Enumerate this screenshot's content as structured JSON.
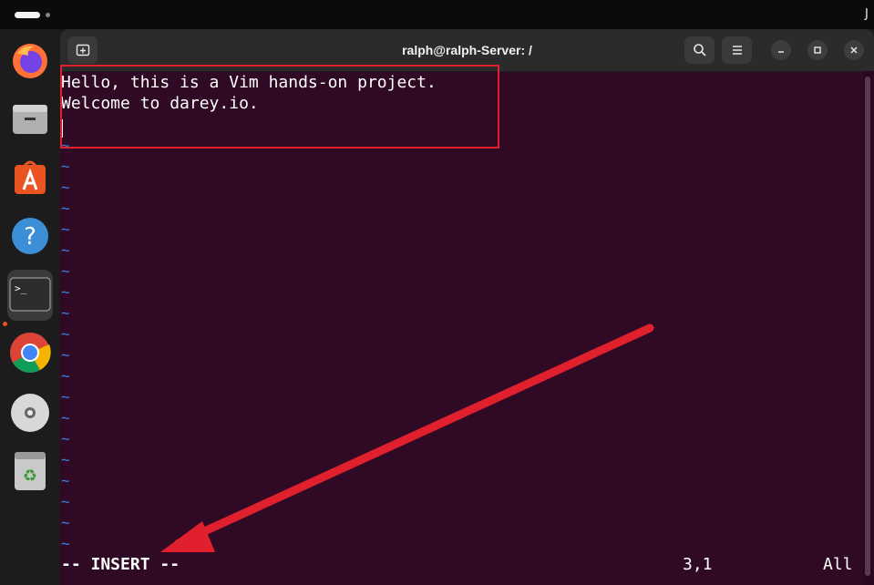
{
  "topbar": {
    "edge_glyph": "J"
  },
  "dock": {
    "items": [
      {
        "name": "firefox"
      },
      {
        "name": "files"
      },
      {
        "name": "app-center"
      },
      {
        "name": "help"
      },
      {
        "name": "terminal"
      },
      {
        "name": "chrome"
      },
      {
        "name": "disc"
      },
      {
        "name": "trash"
      }
    ]
  },
  "window": {
    "title": "ralph@ralph-Server: /",
    "new_tab_icon": "new-tab-icon",
    "search_icon": "search-icon",
    "menu_icon": "hamburger-menu-icon"
  },
  "vim": {
    "lines": [
      "Hello, this is a Vim hands-on project.",
      "Welcome to darey.io."
    ],
    "empty_line_marker": "~",
    "mode": "-- INSERT --",
    "cursor_position": "3,1",
    "scroll_position": "All"
  },
  "colors": {
    "terminal_bg": "#300a24",
    "tilde": "#3d7ed8",
    "annotation": "#e0202c"
  }
}
